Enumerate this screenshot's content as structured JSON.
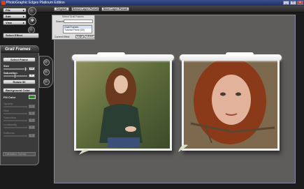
{
  "window": {
    "title": "PhotoGraphic Edges Platinum Edition",
    "controls": [
      "_",
      "□",
      "×"
    ]
  },
  "toolbar": {
    "original_label": "Original",
    "select_preset_label": "Select Layer Preset",
    "save_preset_label": "Save Layer Preset"
  },
  "menu": {
    "file": "File",
    "edit": "Edit",
    "view": "View",
    "select_effect": "Select Effect"
  },
  "panel": {
    "title": "Grail Frames",
    "select_frame_button": "Select Frame",
    "size_label": "Size",
    "size_value": "100",
    "saturation_label": "Saturation",
    "saturation_value": "0",
    "rotate_button": "Rotate 90",
    "background_color_label": "Background Color",
    "fill_color_label": "Fill Color",
    "opacity_label": "Opacity",
    "opacity_value": "0",
    "size2_label": "Size",
    "size2_value": "0",
    "saturation2_label": "Saturation",
    "saturation2_value": "0",
    "luminosity_label": "Luminosity",
    "luminosity_value": "0",
    "softness_label": "Softness",
    "softness_value": "0",
    "orientation": "Orientation: Normal",
    "fill_color_hex": "#2f8a2f"
  },
  "search_popup": {
    "title": "Select Grail Frames",
    "search_label": "Search",
    "items": [
      "Grail Frames",
      "Tutorial Photo (00)"
    ],
    "footer_label": "Current Effect",
    "ok_label": "Edge",
    "cancel_label": "Cancel"
  },
  "colors": {
    "titlebar": "#2b3d7c",
    "canvas": "#5f5c5c",
    "frame_border": "#efefef"
  }
}
